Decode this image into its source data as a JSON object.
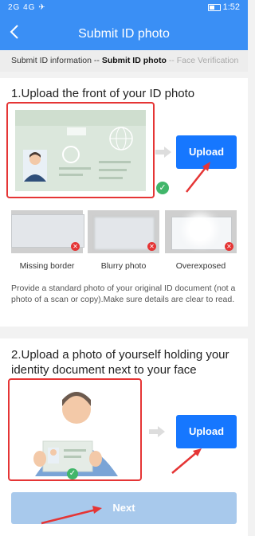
{
  "status_bar": {
    "left": "2G 4G ✈",
    "time": "1:52"
  },
  "header": {
    "title": "Submit ID photo"
  },
  "steps": {
    "step1": "Submit ID information",
    "sep1": "--",
    "step2": "Submit ID photo",
    "sep2": "--",
    "step3": "Face Verification"
  },
  "section1": {
    "heading": "1.Upload the front of your ID photo",
    "upload_label": "Upload",
    "examples": [
      {
        "caption": "Missing border"
      },
      {
        "caption": "Blurry photo"
      },
      {
        "caption": "Overexposed"
      }
    ],
    "description": "Provide a standard photo of your original ID document (not a photo of a scan or copy).Make sure details are clear to read."
  },
  "section2": {
    "heading": "2.Upload a photo of yourself holding your identity document next to your face",
    "upload_label": "Upload"
  },
  "next_label": "Next",
  "colors": {
    "primary": "#1677ff",
    "header": "#3a8ff5",
    "highlight": "#e53535"
  }
}
